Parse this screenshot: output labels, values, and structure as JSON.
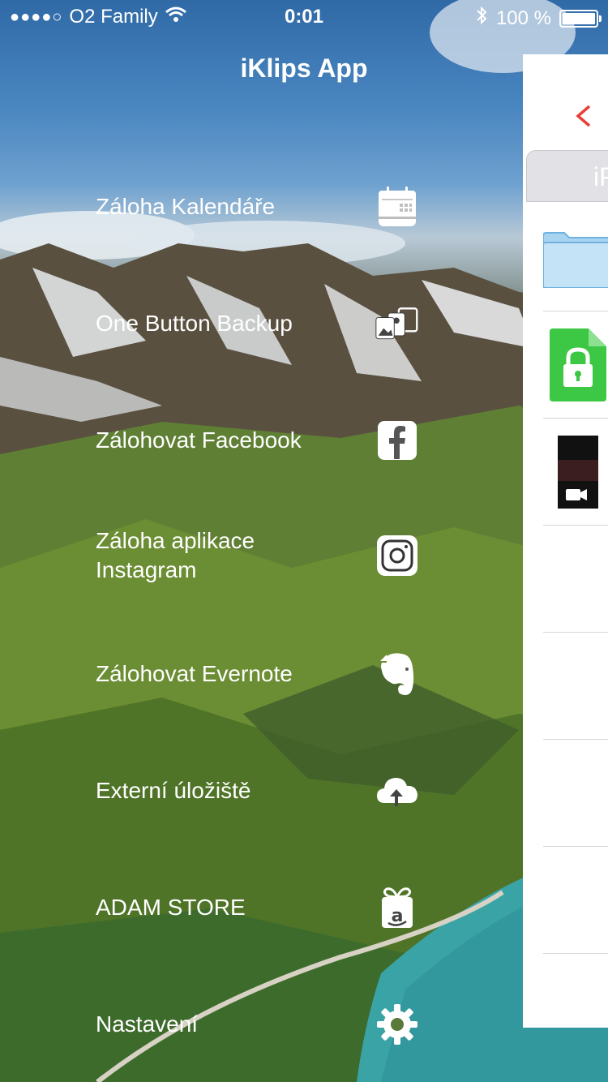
{
  "status_bar": {
    "carrier": "O2 Family",
    "time": "0:01",
    "battery": "100 %"
  },
  "app_title": "iKlips App",
  "menu": [
    {
      "label": "Záloha Kalendáře",
      "icon": "calendar-icon"
    },
    {
      "label": "One Button Backup",
      "icon": "media-backup-icon"
    },
    {
      "label": "Zálohovat Facebook",
      "icon": "facebook-icon"
    },
    {
      "label": "Záloha aplikace Instagram",
      "icon": "instagram-icon"
    },
    {
      "label": "Zálohovat Evernote",
      "icon": "evernote-icon"
    },
    {
      "label": "Externí úložiště",
      "icon": "cloud-upload-icon"
    },
    {
      "label": "ADAM STORE",
      "icon": "gift-store-icon"
    },
    {
      "label": "Nastavení",
      "icon": "gear-icon"
    }
  ],
  "panel": {
    "segment_label": "iP",
    "accent_color": "#e8403a",
    "lock_file_color": "#3cc845",
    "folder_color": "#bfe0f6"
  }
}
